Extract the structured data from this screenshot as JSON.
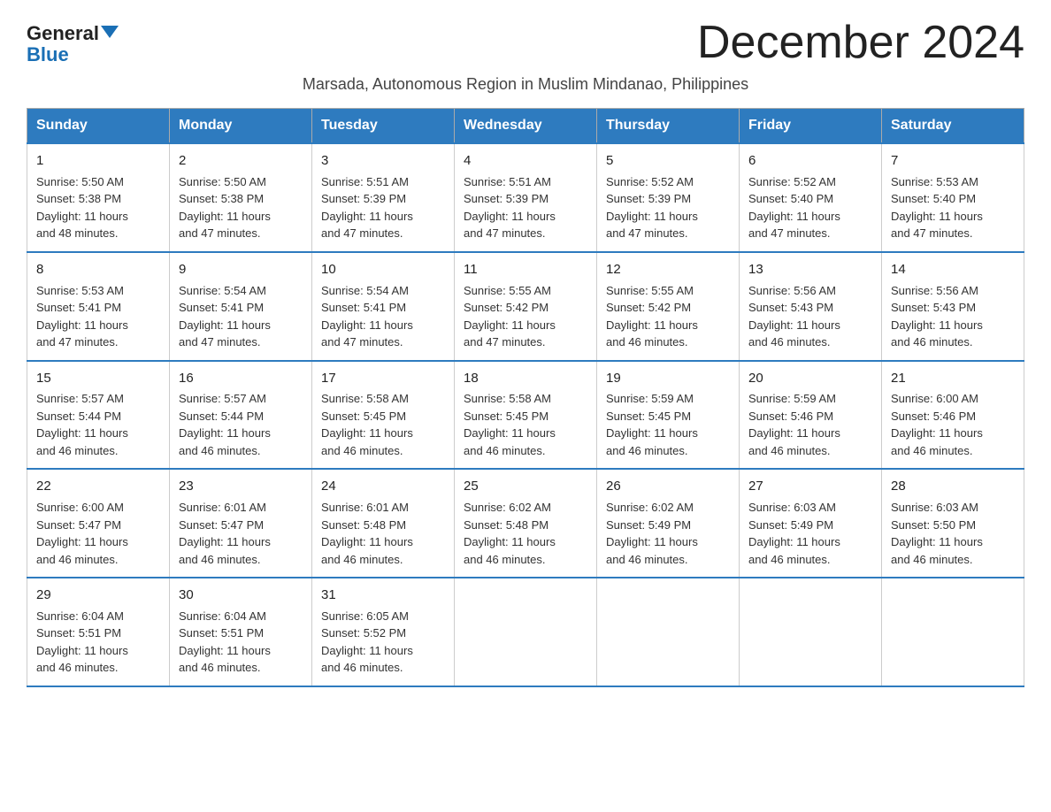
{
  "logo": {
    "general": "General",
    "blue": "Blue"
  },
  "title": "December 2024",
  "subtitle": "Marsada, Autonomous Region in Muslim Mindanao, Philippines",
  "days_of_week": [
    "Sunday",
    "Monday",
    "Tuesday",
    "Wednesday",
    "Thursday",
    "Friday",
    "Saturday"
  ],
  "weeks": [
    [
      {
        "day": "1",
        "info": "Sunrise: 5:50 AM\nSunset: 5:38 PM\nDaylight: 11 hours\nand 48 minutes."
      },
      {
        "day": "2",
        "info": "Sunrise: 5:50 AM\nSunset: 5:38 PM\nDaylight: 11 hours\nand 47 minutes."
      },
      {
        "day": "3",
        "info": "Sunrise: 5:51 AM\nSunset: 5:39 PM\nDaylight: 11 hours\nand 47 minutes."
      },
      {
        "day": "4",
        "info": "Sunrise: 5:51 AM\nSunset: 5:39 PM\nDaylight: 11 hours\nand 47 minutes."
      },
      {
        "day": "5",
        "info": "Sunrise: 5:52 AM\nSunset: 5:39 PM\nDaylight: 11 hours\nand 47 minutes."
      },
      {
        "day": "6",
        "info": "Sunrise: 5:52 AM\nSunset: 5:40 PM\nDaylight: 11 hours\nand 47 minutes."
      },
      {
        "day": "7",
        "info": "Sunrise: 5:53 AM\nSunset: 5:40 PM\nDaylight: 11 hours\nand 47 minutes."
      }
    ],
    [
      {
        "day": "8",
        "info": "Sunrise: 5:53 AM\nSunset: 5:41 PM\nDaylight: 11 hours\nand 47 minutes."
      },
      {
        "day": "9",
        "info": "Sunrise: 5:54 AM\nSunset: 5:41 PM\nDaylight: 11 hours\nand 47 minutes."
      },
      {
        "day": "10",
        "info": "Sunrise: 5:54 AM\nSunset: 5:41 PM\nDaylight: 11 hours\nand 47 minutes."
      },
      {
        "day": "11",
        "info": "Sunrise: 5:55 AM\nSunset: 5:42 PM\nDaylight: 11 hours\nand 47 minutes."
      },
      {
        "day": "12",
        "info": "Sunrise: 5:55 AM\nSunset: 5:42 PM\nDaylight: 11 hours\nand 46 minutes."
      },
      {
        "day": "13",
        "info": "Sunrise: 5:56 AM\nSunset: 5:43 PM\nDaylight: 11 hours\nand 46 minutes."
      },
      {
        "day": "14",
        "info": "Sunrise: 5:56 AM\nSunset: 5:43 PM\nDaylight: 11 hours\nand 46 minutes."
      }
    ],
    [
      {
        "day": "15",
        "info": "Sunrise: 5:57 AM\nSunset: 5:44 PM\nDaylight: 11 hours\nand 46 minutes."
      },
      {
        "day": "16",
        "info": "Sunrise: 5:57 AM\nSunset: 5:44 PM\nDaylight: 11 hours\nand 46 minutes."
      },
      {
        "day": "17",
        "info": "Sunrise: 5:58 AM\nSunset: 5:45 PM\nDaylight: 11 hours\nand 46 minutes."
      },
      {
        "day": "18",
        "info": "Sunrise: 5:58 AM\nSunset: 5:45 PM\nDaylight: 11 hours\nand 46 minutes."
      },
      {
        "day": "19",
        "info": "Sunrise: 5:59 AM\nSunset: 5:45 PM\nDaylight: 11 hours\nand 46 minutes."
      },
      {
        "day": "20",
        "info": "Sunrise: 5:59 AM\nSunset: 5:46 PM\nDaylight: 11 hours\nand 46 minutes."
      },
      {
        "day": "21",
        "info": "Sunrise: 6:00 AM\nSunset: 5:46 PM\nDaylight: 11 hours\nand 46 minutes."
      }
    ],
    [
      {
        "day": "22",
        "info": "Sunrise: 6:00 AM\nSunset: 5:47 PM\nDaylight: 11 hours\nand 46 minutes."
      },
      {
        "day": "23",
        "info": "Sunrise: 6:01 AM\nSunset: 5:47 PM\nDaylight: 11 hours\nand 46 minutes."
      },
      {
        "day": "24",
        "info": "Sunrise: 6:01 AM\nSunset: 5:48 PM\nDaylight: 11 hours\nand 46 minutes."
      },
      {
        "day": "25",
        "info": "Sunrise: 6:02 AM\nSunset: 5:48 PM\nDaylight: 11 hours\nand 46 minutes."
      },
      {
        "day": "26",
        "info": "Sunrise: 6:02 AM\nSunset: 5:49 PM\nDaylight: 11 hours\nand 46 minutes."
      },
      {
        "day": "27",
        "info": "Sunrise: 6:03 AM\nSunset: 5:49 PM\nDaylight: 11 hours\nand 46 minutes."
      },
      {
        "day": "28",
        "info": "Sunrise: 6:03 AM\nSunset: 5:50 PM\nDaylight: 11 hours\nand 46 minutes."
      }
    ],
    [
      {
        "day": "29",
        "info": "Sunrise: 6:04 AM\nSunset: 5:51 PM\nDaylight: 11 hours\nand 46 minutes."
      },
      {
        "day": "30",
        "info": "Sunrise: 6:04 AM\nSunset: 5:51 PM\nDaylight: 11 hours\nand 46 minutes."
      },
      {
        "day": "31",
        "info": "Sunrise: 6:05 AM\nSunset: 5:52 PM\nDaylight: 11 hours\nand 46 minutes."
      },
      null,
      null,
      null,
      null
    ]
  ]
}
